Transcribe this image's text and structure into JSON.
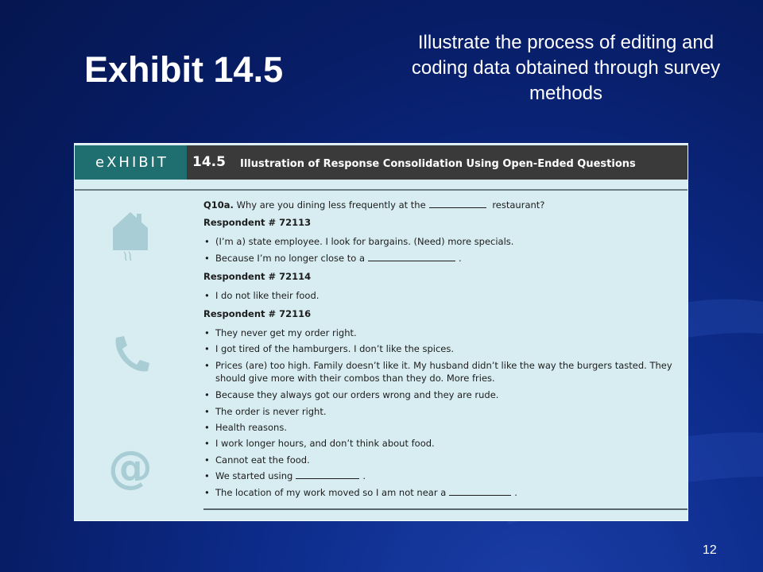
{
  "slide": {
    "title": "Exhibit 14.5",
    "subtitle": "Illustrate the process of editing and coding data obtained through survey methods",
    "page_number": "12"
  },
  "exhibit": {
    "brand": "eXHIBIT",
    "number": "14.5",
    "caption": "Illustration of Response Consolidation Using Open-Ended Questions",
    "question_id": "Q10a.",
    "question_before": "Why are you dining less frequently at the",
    "question_after": "restaurant?",
    "respondents": [
      {
        "label": "Respondent # 72113",
        "answers": [
          {
            "before": "(I’m a) state employee. I look for bargains. (Need) more specials.",
            "blank": false,
            "after": ""
          },
          {
            "before": "Because I’m no longer close to a",
            "blank": true,
            "after": "."
          }
        ]
      },
      {
        "label": "Respondent # 72114",
        "answers": [
          {
            "before": "I do not like their food.",
            "blank": false,
            "after": ""
          }
        ]
      },
      {
        "label": "Respondent # 72116",
        "answers": [
          {
            "before": "They never get my order right.",
            "blank": false,
            "after": ""
          },
          {
            "before": "I got tired of the hamburgers. I don’t like the spices.",
            "blank": false,
            "after": ""
          },
          {
            "before": "Prices (are) too high. Family doesn’t like it. My husband didn’t like the way the burgers tasted. They should give more with their combos than they do. More fries.",
            "blank": false,
            "after": ""
          },
          {
            "before": "Because they always got our orders wrong and they are rude.",
            "blank": false,
            "after": ""
          },
          {
            "before": "The order is never right.",
            "blank": false,
            "after": ""
          },
          {
            "before": "Health reasons.",
            "blank": false,
            "after": ""
          },
          {
            "before": "I work longer hours, and don’t think about food.",
            "blank": false,
            "after": ""
          },
          {
            "before": "Cannot eat the food.",
            "blank": false,
            "after": ""
          },
          {
            "before": "We started using",
            "blank": true,
            "after": "."
          },
          {
            "before": "The location of my work moved so I am not near a",
            "blank": true,
            "after": "."
          }
        ]
      }
    ],
    "icons": [
      "house-icon",
      "phone-icon",
      "at-sign-icon"
    ],
    "colors": {
      "background_top": "#051650",
      "background_bottom": "#1b3fa8",
      "panel": "#d8edf2",
      "header_bar": "#3a3a3a",
      "brand_block": "#1f6e70",
      "icon_tint": "#a9cdd4"
    }
  }
}
